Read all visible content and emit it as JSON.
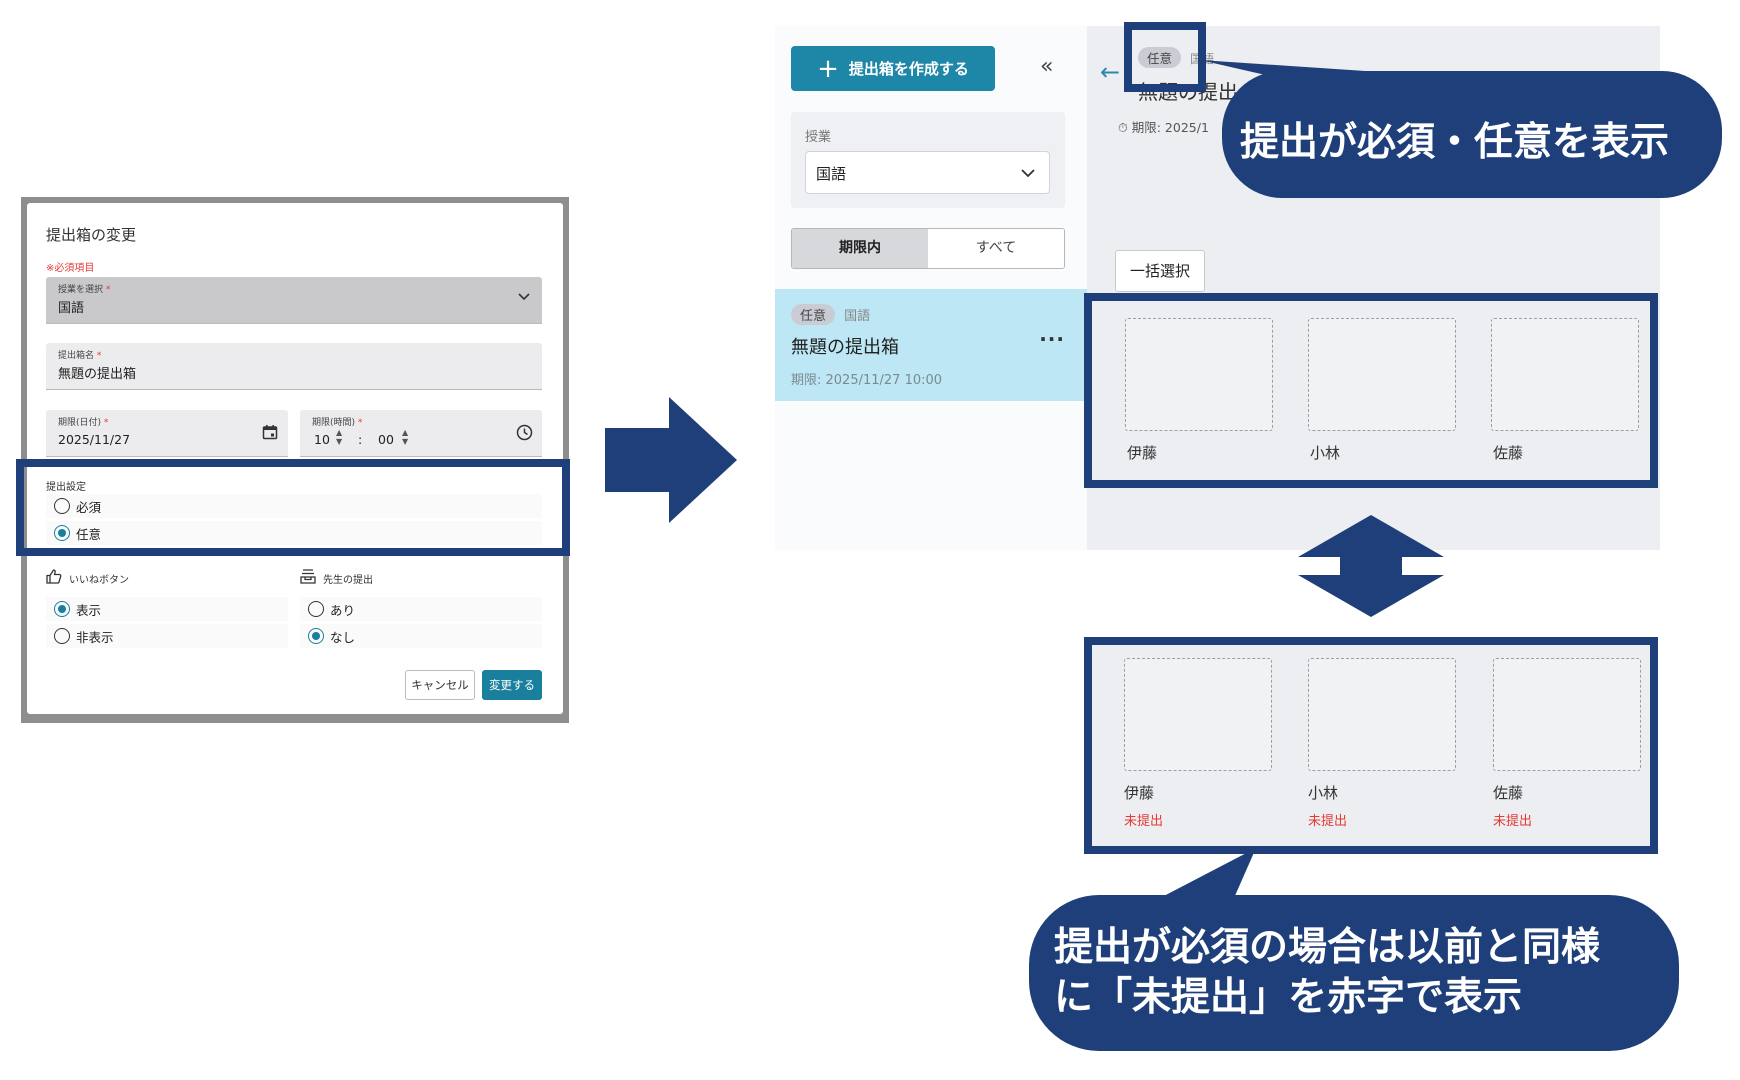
{
  "dialog": {
    "title": "提出箱の変更",
    "required_note": "※必須項目",
    "class_field": {
      "label": "授業を選択",
      "value": "国語"
    },
    "name_field": {
      "label": "提出箱名",
      "value": "無題の提出箱"
    },
    "date_field": {
      "label": "期限(日付)",
      "value": "2025/11/27"
    },
    "time_field": {
      "label": "期限(時間)",
      "hour": "10",
      "sep": ":",
      "minute": "00"
    },
    "submission_setting": {
      "label": "提出設定",
      "options": [
        {
          "label": "必須",
          "checked": false
        },
        {
          "label": "任意",
          "checked": true
        }
      ]
    },
    "like_button": {
      "label": "いいねボタン",
      "options": [
        {
          "label": "表示",
          "checked": true
        },
        {
          "label": "非表示",
          "checked": false
        }
      ]
    },
    "teacher_submission": {
      "label": "先生の提出",
      "options": [
        {
          "label": "あり",
          "checked": false
        },
        {
          "label": "なし",
          "checked": true
        }
      ]
    },
    "cancel_label": "キャンセル",
    "confirm_label": "変更する"
  },
  "app": {
    "create_button": "提出箱を作成する",
    "collapse_icon": "«",
    "class_filter": {
      "label": "授業",
      "value": "国語"
    },
    "segments": [
      "期限内",
      "すべて"
    ],
    "list_item": {
      "badge": "任意",
      "subject": "国語",
      "title": "無題の提出箱",
      "deadline": "期限: 2025/11/27 10:00",
      "more": "···"
    },
    "header": {
      "badge": "任意",
      "subject": "国語",
      "title": "無題の提出",
      "deadline": "期限: 2025/1"
    },
    "bulk_select": "一括選択",
    "students": [
      "伊藤",
      "小林",
      "佐藤"
    ],
    "status_not_submitted": "未提出"
  },
  "callouts": {
    "top": "提出が必須・任意を表示",
    "bottom_line1": "提出が必須の場合は以前と同様",
    "bottom_line2": "に「未提出」を赤字で表示"
  },
  "colors": {
    "highlight": "#1f3f7a",
    "accent": "#1e87a8",
    "alert": "#e53935",
    "selected_item": "#bde7f4"
  }
}
